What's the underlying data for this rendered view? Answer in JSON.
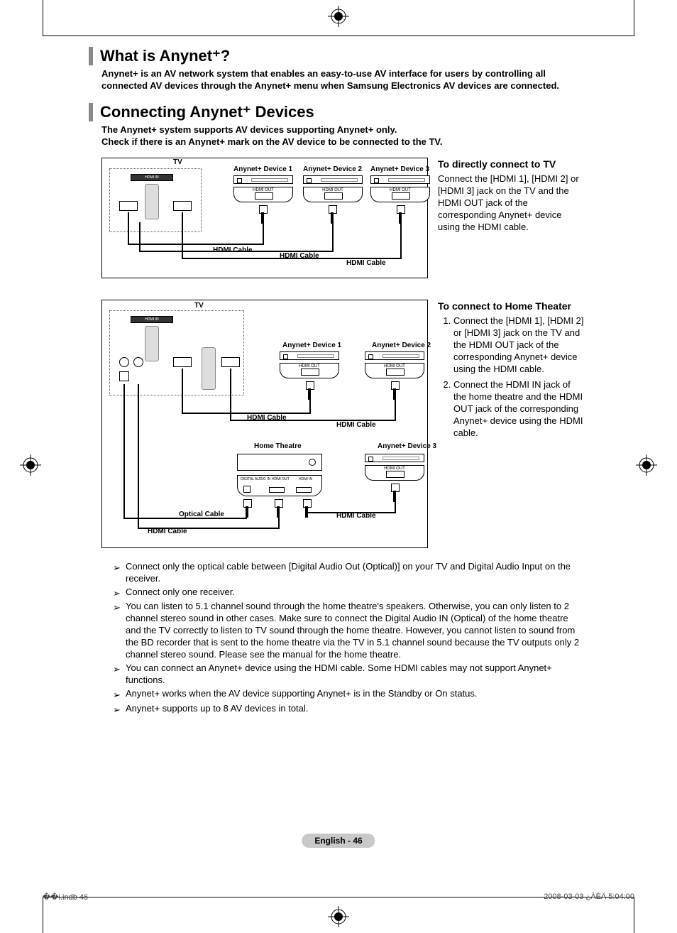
{
  "sections": {
    "what_is": {
      "title": "What is Anynet⁺?",
      "intro": "Anynet+ is an AV network system that enables an easy-to-use AV interface for users by controlling all connected AV devices through the Anynet+ menu when Samsung Electronics AV devices are connected."
    },
    "connecting": {
      "title": "Connecting Anynet⁺ Devices",
      "intro": "The Anynet+ system supports AV devices supporting Anynet+ only.\nCheck if there is an Anynet+ mark on the AV device to be connected to the TV."
    }
  },
  "diagram1": {
    "tv": "TV",
    "device1": "Anynet+ Device 1",
    "device2": "Anynet+ Device 2",
    "device3": "Anynet+ Device 3",
    "hdmi_cable": "HDMI Cable"
  },
  "direct_connect": {
    "head": "To directly connect to TV",
    "body": "Connect the [HDMI 1], [HDMI 2] or [HDMI 3] jack on the TV and the HDMI OUT jack of the corresponding Anynet+ device using the HDMI cable."
  },
  "diagram2": {
    "tv": "TV",
    "device1": "Anynet+ Device 1",
    "device2": "Anynet+ Device 2",
    "device3": "Anynet+ Device 3",
    "home_theatre": "Home Theatre",
    "hdmi_cable": "HDMI Cable",
    "optical_cable": "Optical Cable",
    "hdmi_out": "HDMI OUT",
    "hdmi_in": "HDMI IN",
    "digital_audio_in": "DIGITAL AUDIO IN"
  },
  "home_theater": {
    "head": "To connect to Home Theater",
    "steps": [
      "Connect the [HDMI 1], [HDMI 2] or [HDMI 3] jack on the TV and the HDMI OUT jack of the corresponding Anynet+ device using the HDMI cable.",
      "Connect the HDMI IN jack of the home theatre and the HDMI OUT jack of the corresponding Anynet+ device using the HDMI cable."
    ]
  },
  "notes": [
    "Connect only the optical cable between [Digital Audio Out (Optical)] on your TV and Digital Audio Input on the receiver.",
    "Connect only one receiver.",
    "You can listen to 5.1 channel sound through the home theatre's speakers. Otherwise, you can only listen to 2 channel stereo sound in other cases. Make sure to connect the Digital Audio IN (Optical) of the home theatre and the TV correctly to listen to TV sound through the home theatre. However, you cannot listen to sound from the BD recorder that is sent to the home theatre via the TV in 5.1 channel sound because the TV outputs only 2 channel stereo sound. Please see the manual for the home theatre.",
    "You can connect an Anynet+ device using the HDMI cable. Some HDMI cables may not support Anynet+ functions.",
    "Anynet+ works when the AV device supporting Anynet+ is in the Standby or On status.",
    "Anynet+ supports up to 8 AV devices in total."
  ],
  "page_indicator": "English - 46",
  "footer": {
    "left": "��i.indb   46",
    "right": "2008-03-03   ¿ÀÈÄ 5:04:00"
  }
}
